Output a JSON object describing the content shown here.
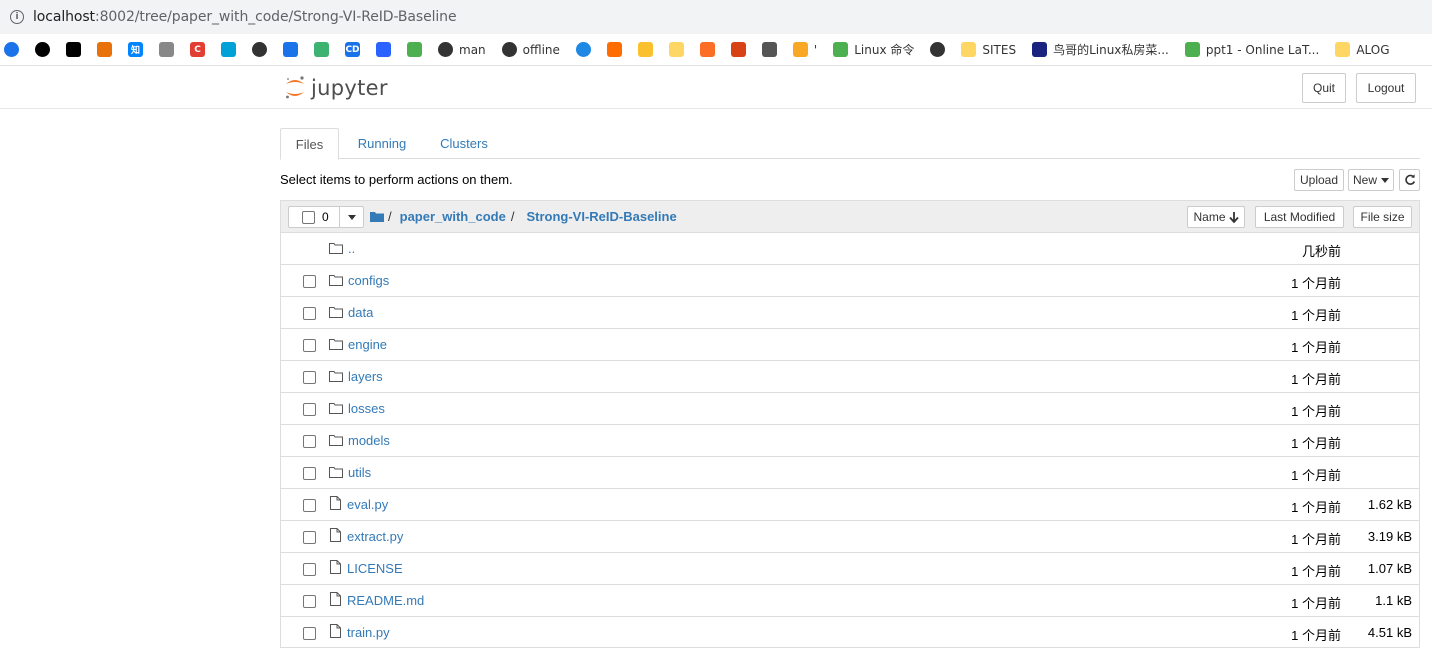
{
  "browser": {
    "url_host": "localhost",
    "url_path": ":8002/tree/paper_with_code/Strong-VI-ReID-Baseline",
    "bookmarks": [
      {
        "icon": "globe-blue-icon",
        "label": "",
        "color": "#1a73e8"
      },
      {
        "icon": "github-icon",
        "label": "",
        "color": "#000000"
      },
      {
        "icon": "graduation-cap-icon",
        "label": "",
        "color": "#000000"
      },
      {
        "icon": "arrow-orange-icon",
        "label": "",
        "color": "#e8710a"
      },
      {
        "icon": "zhihu-icon",
        "label": "",
        "glyph": "知",
        "color": "#0084ff"
      },
      {
        "icon": "grid-icon",
        "label": "",
        "color": "#888888"
      },
      {
        "icon": "csdn-icon",
        "label": "",
        "glyph": "C",
        "color": "#e33e33"
      },
      {
        "icon": "bilibili-icon",
        "label": "",
        "color": "#00a1d6"
      },
      {
        "icon": "chrome-g-icon",
        "label": "",
        "color": "#333333"
      },
      {
        "icon": "search-gear-icon",
        "label": "",
        "color": "#1a73e8"
      },
      {
        "icon": "green-ring-icon",
        "label": "",
        "color": "#3cb371"
      },
      {
        "icon": "cd-icon",
        "label": "",
        "glyph": "CD",
        "color": "#1a73e8"
      },
      {
        "icon": "barcode-icon",
        "label": "",
        "color": "#2962ff"
      },
      {
        "icon": "leaf-icon",
        "label": "",
        "color": "#4caf50"
      },
      {
        "icon": "globe-icon",
        "label": "man",
        "color": "#333333"
      },
      {
        "icon": "chrome-g-icon",
        "label": "offline",
        "color": "#333333"
      },
      {
        "icon": "edge-icon",
        "label": "",
        "color": "#1e88e5"
      },
      {
        "icon": "bracket-icon",
        "label": "",
        "color": "#ff6d00"
      },
      {
        "icon": "coin-icon",
        "label": "",
        "color": "#fbc02d"
      },
      {
        "icon": "folder-yellow-icon",
        "label": "",
        "color": "#fdd663"
      },
      {
        "icon": "gitlab-icon",
        "label": "",
        "color": "#fc6d26"
      },
      {
        "icon": "app-red-icon",
        "label": "",
        "color": "#d84315"
      },
      {
        "icon": "skull-icon",
        "label": "",
        "color": "#555555"
      },
      {
        "icon": "colorful-grid-icon",
        "label": "'",
        "color": "#f9a825"
      },
      {
        "icon": "green-badge-icon",
        "label": "Linux 命令",
        "color": "#4caf50"
      },
      {
        "icon": "globe-icon",
        "label": "",
        "color": "#333333"
      },
      {
        "icon": "folder-yellow-icon",
        "label": "SITES",
        "color": "#fdd663"
      },
      {
        "icon": "m-logo-icon",
        "label": "鸟哥的Linux私房菜...",
        "color": "#1a237e"
      },
      {
        "icon": "leaf-icon",
        "label": "ppt1 - Online LaT...",
        "color": "#4caf50"
      },
      {
        "icon": "folder-yellow-icon",
        "label": "ALOG",
        "color": "#fdd663"
      }
    ]
  },
  "header": {
    "logo_text": "jupyter",
    "quit_label": "Quit",
    "logout_label": "Logout"
  },
  "tabs": [
    {
      "label": "Files",
      "active": true
    },
    {
      "label": "Running",
      "active": false
    },
    {
      "label": "Clusters",
      "active": false
    }
  ],
  "toolbar": {
    "hint": "Select items to perform actions on them.",
    "upload_label": "Upload",
    "new_label": "New",
    "refresh_icon": "refresh-icon"
  },
  "list_header": {
    "selected_count": "0",
    "breadcrumb": [
      "paper_with_code",
      "Strong-VI-ReID-Baseline"
    ],
    "sort_name_label": "Name",
    "last_modified_label": "Last Modified",
    "file_size_label": "File size"
  },
  "items": [
    {
      "type": "parent",
      "name": "..",
      "modified": "几秒前",
      "size": ""
    },
    {
      "type": "folder",
      "name": "configs",
      "modified": "1 个月前",
      "size": ""
    },
    {
      "type": "folder",
      "name": "data",
      "modified": "1 个月前",
      "size": ""
    },
    {
      "type": "folder",
      "name": "engine",
      "modified": "1 个月前",
      "size": ""
    },
    {
      "type": "folder",
      "name": "layers",
      "modified": "1 个月前",
      "size": ""
    },
    {
      "type": "folder",
      "name": "losses",
      "modified": "1 个月前",
      "size": ""
    },
    {
      "type": "folder",
      "name": "models",
      "modified": "1 个月前",
      "size": ""
    },
    {
      "type": "folder",
      "name": "utils",
      "modified": "1 个月前",
      "size": ""
    },
    {
      "type": "file",
      "name": "eval.py",
      "modified": "1 个月前",
      "size": "1.62 kB"
    },
    {
      "type": "file",
      "name": "extract.py",
      "modified": "1 个月前",
      "size": "3.19 kB"
    },
    {
      "type": "file",
      "name": "LICENSE",
      "modified": "1 个月前",
      "size": "1.07 kB"
    },
    {
      "type": "file",
      "name": "README.md",
      "modified": "1 个月前",
      "size": "1.1 kB"
    },
    {
      "type": "file",
      "name": "train.py",
      "modified": "1 个月前",
      "size": "4.51 kB"
    }
  ]
}
